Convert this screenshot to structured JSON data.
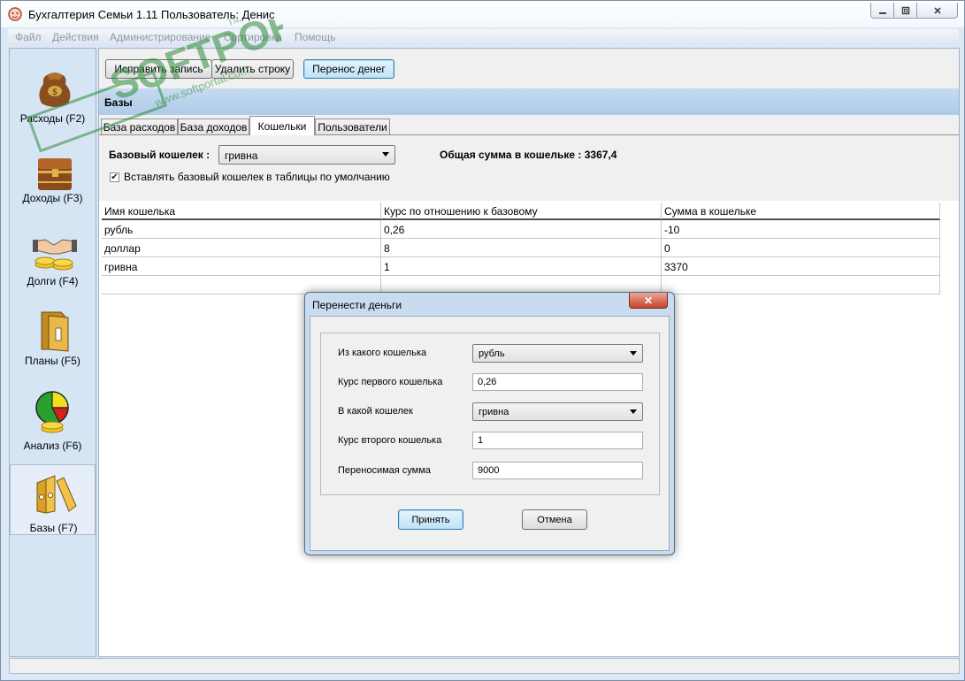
{
  "window": {
    "title": "Бухгалтерия Семьи 1.11",
    "user": "Пользователь: Денис"
  },
  "menu": [
    "Файл",
    "Действия",
    "Администрирование",
    "Сортировка",
    "Помощь"
  ],
  "sidebar": {
    "items": [
      {
        "label": "Расходы (F2)",
        "icon": "coins-bag-icon"
      },
      {
        "label": "Доходы (F3)",
        "icon": "treasure-chest-icon"
      },
      {
        "label": "Долги (F4)",
        "icon": "handshake-coins-icon"
      },
      {
        "label": "Планы (F5)",
        "icon": "folder-icon"
      },
      {
        "label": "Анализ (F6)",
        "icon": "pie-chart-icon"
      },
      {
        "label": "Базы (F7)",
        "icon": "binders-icon"
      }
    ],
    "active": "Базы (F7)"
  },
  "toolbar": {
    "edit_label": "Исправить запись",
    "delete_label": "Удалить строку",
    "transfer_label": "Перенос денег"
  },
  "section": {
    "title": "Базы"
  },
  "tabs": [
    "База расходов",
    "База доходов",
    "Кошельки",
    "Пользователи"
  ],
  "active_tab": "Кошельки",
  "wallets_panel": {
    "base_wallet_label": "Базовый кошелек :",
    "base_wallet_value": "гривна",
    "total_text": "Общая сумма в кошельке : 3367,4",
    "default_checkbox_label": "Вставлять базовый кошелек в таблицы по умолчанию",
    "default_checked": true
  },
  "grid": {
    "columns": [
      "Имя кошелька",
      "Курс по отношению к базовому",
      "Сумма в кошельке"
    ],
    "rows": [
      [
        "рубль",
        "0,26",
        "-10"
      ],
      [
        "доллар",
        "8",
        "0"
      ],
      [
        "гривна",
        "1",
        "3370"
      ],
      [
        "",
        "",
        ""
      ]
    ]
  },
  "dialog": {
    "title": "Перенести деньги",
    "from_label": "Из какого кошелька",
    "from_value": "рубль",
    "rate1_label": "Курс первого кошелька",
    "rate1_value": "0,26",
    "to_label": "В какой кошелек",
    "to_value": "гривна",
    "rate2_label": "Курс второго кошелька",
    "rate2_value": "1",
    "amount_label": "Переносимая сумма",
    "amount_value": "9000",
    "ok_label": "Принять",
    "cancel_label": "Отмена",
    "close_glyph": "✕"
  },
  "watermark": {
    "brand": "SOFTPORTAL",
    "url": "www.softportal.com",
    "tm": "TM"
  }
}
